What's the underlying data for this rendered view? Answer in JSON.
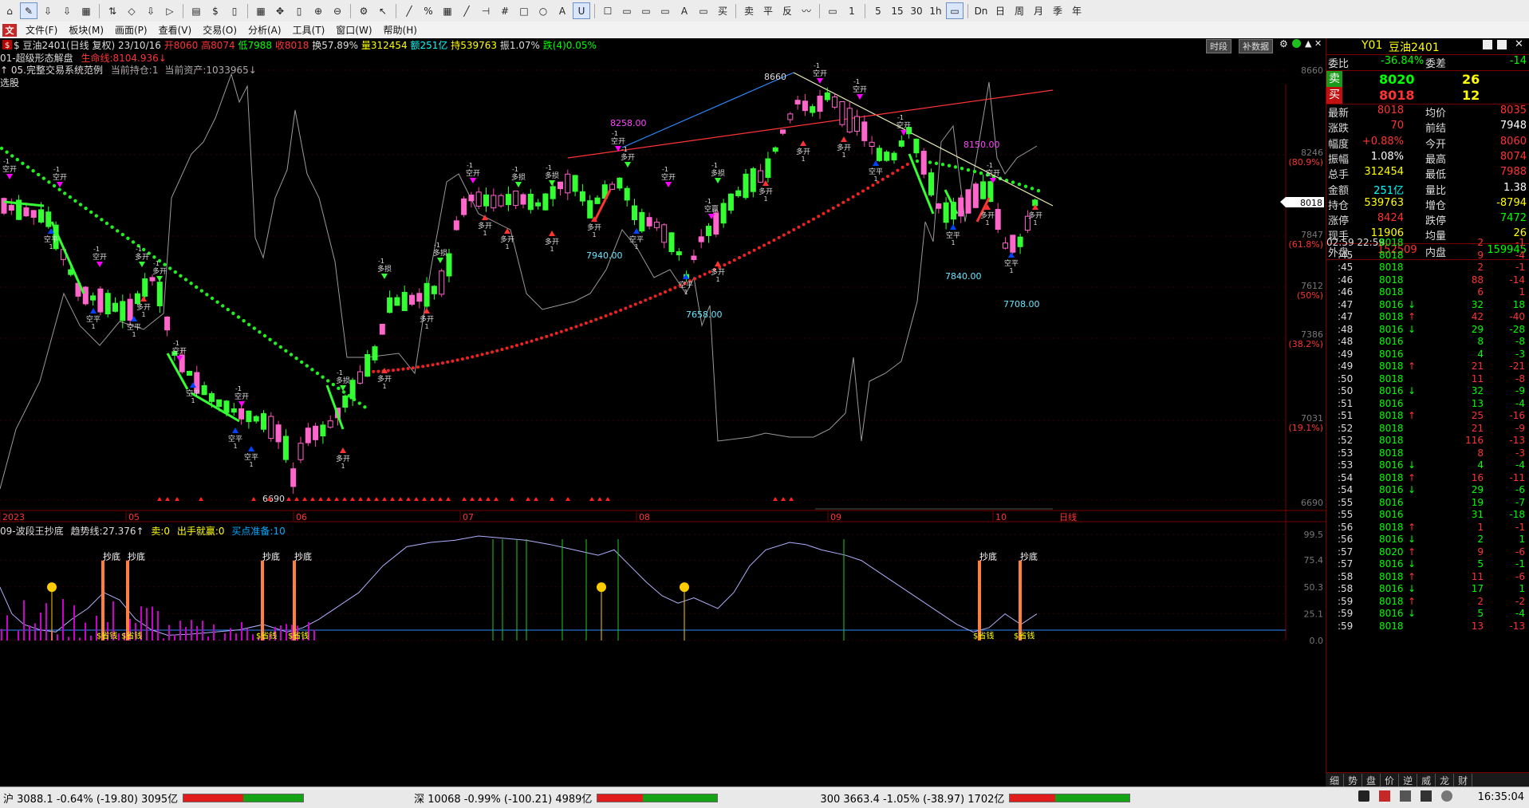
{
  "toolbar": {
    "items": [
      "⌂",
      "✎",
      "⇩",
      "⇩",
      "▦",
      "⇅",
      "◇",
      "⇩",
      "▷",
      "▤",
      "$",
      "▯",
      "▦",
      "✥",
      "▯",
      "⊕",
      "⊖",
      "⚙",
      "↖",
      "╱",
      "%",
      "▦",
      "╱",
      "⊣",
      "#",
      "□",
      "○",
      "A",
      "U",
      "☐",
      "▭",
      "▭",
      "▭",
      "A",
      "▭",
      "买",
      "卖",
      "平",
      "反",
      "〰",
      "▭",
      "1",
      "5",
      "15",
      "30",
      "1h",
      "▭",
      "Dn",
      "日",
      "周",
      "月",
      "季",
      "年"
    ],
    "selected": [
      1,
      28,
      46
    ]
  },
  "menu": {
    "items": [
      "文件(F)",
      "板块(M)",
      "画面(P)",
      "查看(V)",
      "交易(O)",
      "分析(A)",
      "工具(T)",
      "窗口(W)",
      "帮助(H)"
    ]
  },
  "chart": {
    "title_prefix": "$ 豆油2401(日线 复权) 23/10/16",
    "open_label": "开8060",
    "high_label": "高8074",
    "low_label": "低7988",
    "close_label": "收8018",
    "turnover_label": "换57.89%",
    "volume_label": "量312454",
    "amount_label": "额251亿",
    "position_label": "持539763",
    "amplitude_label": "振1.07%",
    "fall_label": "跌(4)0.05%",
    "line2_name": "01-超级形态解盘",
    "line2_value": "生命线:8104.936↓",
    "line3_name": "↑ 05.完整交易系统范例",
    "line3_hold": "当前持仓:1",
    "line3_assets": "当前资产:1033965↓",
    "line4": "选股",
    "btn_time": "时段",
    "btn_supp": "补数据",
    "right_axis": [
      "8660",
      "8246",
      "(80.9%)",
      "7847",
      "(61.8%)",
      "7612",
      "(50%)",
      "7386",
      "(38.2%)",
      "7031",
      "(19.1%)",
      "6690"
    ],
    "price_tag": "8018",
    "date_axis": [
      "2023",
      "05",
      "06",
      "07",
      "08",
      "09",
      "10",
      "日线"
    ],
    "annotations": [
      "8660",
      "8258.00",
      "8150.00",
      "7940.00",
      "7658.00",
      "7840.00",
      "7708.00",
      "6690"
    ],
    "signals": [
      "空开",
      "多开",
      "空平",
      "多平",
      "多损",
      "空赢",
      "多赢",
      "空损",
      "-1",
      "1"
    ]
  },
  "indicator": {
    "name": "09-波段王抄底",
    "trend_label": "趋势线:27.376↑",
    "sell_label": "卖:0",
    "hand_label": "出手就赢:0",
    "buy_label": "买点准备:10",
    "axis": [
      "99.5",
      "75.4",
      "50.3",
      "25.1",
      "0.0"
    ],
    "tag_bottom": "抄底",
    "tag_money": "$省钱"
  },
  "quote": {
    "code": "Y01",
    "name": "豆油2401",
    "webi_label": "委比",
    "webi": "-36.84%",
    "weicha_label": "委差",
    "weicha": "-14",
    "sell_label": "卖",
    "sell_price": "8020",
    "sell_vol": "26",
    "buy_label": "买",
    "buy_price": "8018",
    "buy_vol": "12",
    "rows": [
      {
        "l1": "最新",
        "v1": "8018",
        "c1": "#ff3333",
        "l2": "均价",
        "v2": "8035",
        "c2": "#ff3333"
      },
      {
        "l1": "涨跌",
        "v1": "70",
        "c1": "#ff3333",
        "l2": "前结",
        "v2": "7948",
        "c2": "#ffffff"
      },
      {
        "l1": "幅度",
        "v1": "+0.88%",
        "c1": "#ff3333",
        "l2": "今开",
        "v2": "8060",
        "c2": "#ff3333"
      },
      {
        "l1": "振幅",
        "v1": "1.08%",
        "c1": "#ffffff",
        "l2": "最高",
        "v2": "8074",
        "c2": "#ff3333"
      },
      {
        "l1": "总手",
        "v1": "312454",
        "c1": "#ffff00",
        "l2": "最低",
        "v2": "7988",
        "c2": "#ff3333"
      },
      {
        "l1": "金额",
        "v1": "251亿",
        "c1": "#00ffff",
        "l2": "量比",
        "v2": "1.38",
        "c2": "#ffffff"
      },
      {
        "l1": "持仓",
        "v1": "539763",
        "c1": "#ffff00",
        "l2": "增仓",
        "v2": "-8794",
        "c2": "#ffff00"
      },
      {
        "l1": "涨停",
        "v1": "8424",
        "c1": "#ff3333",
        "l2": "跌停",
        "v2": "7472",
        "c2": "#00ff00"
      },
      {
        "l1": "现手",
        "v1": "11906",
        "c1": "#ffff00",
        "l2": "均量",
        "v2": "26",
        "c2": "#ffff00"
      }
    ],
    "outer_label": "外盘",
    "outer": "152509",
    "inner_label": "内盘",
    "inner": "159945"
  },
  "ticks": [
    {
      "t": "02:59 22:59",
      "p": "8018",
      "a": "",
      "v": "2",
      "d": "-1",
      "pc": "#00ff00",
      "vc": "#ff3333"
    },
    {
      "t": ":45",
      "p": "8018",
      "a": "",
      "v": "9",
      "d": "-4",
      "pc": "#00ff00",
      "vc": "#ff3333"
    },
    {
      "t": ":45",
      "p": "8018",
      "a": "",
      "v": "2",
      "d": "-1",
      "pc": "#00ff00",
      "vc": "#ff3333"
    },
    {
      "t": ":46",
      "p": "8018",
      "a": "",
      "v": "88",
      "d": "-14",
      "pc": "#00ff00",
      "vc": "#ff3333"
    },
    {
      "t": ":46",
      "p": "8018",
      "a": "",
      "v": "6",
      "d": "1",
      "pc": "#00ff00",
      "vc": "#ff3333"
    },
    {
      "t": ":47",
      "p": "8016",
      "a": "↓",
      "v": "32",
      "d": "18",
      "pc": "#00ff00",
      "vc": "#00ff00"
    },
    {
      "t": ":47",
      "p": "8018",
      "a": "↑",
      "v": "42",
      "d": "-40",
      "pc": "#00ff00",
      "vc": "#ff3333"
    },
    {
      "t": ":48",
      "p": "8016",
      "a": "↓",
      "v": "29",
      "d": "-28",
      "pc": "#00ff00",
      "vc": "#00ff00"
    },
    {
      "t": ":48",
      "p": "8016",
      "a": "",
      "v": "8",
      "d": "-8",
      "pc": "#00ff00",
      "vc": "#00ff00"
    },
    {
      "t": ":49",
      "p": "8016",
      "a": "",
      "v": "4",
      "d": "-3",
      "pc": "#00ff00",
      "vc": "#00ff00"
    },
    {
      "t": ":49",
      "p": "8018",
      "a": "↑",
      "v": "21",
      "d": "-21",
      "pc": "#00ff00",
      "vc": "#ff3333"
    },
    {
      "t": ":50",
      "p": "8018",
      "a": "",
      "v": "11",
      "d": "-8",
      "pc": "#00ff00",
      "vc": "#ff3333"
    },
    {
      "t": ":50",
      "p": "8016",
      "a": "↓",
      "v": "32",
      "d": "-9",
      "pc": "#00ff00",
      "vc": "#00ff00"
    },
    {
      "t": ":51",
      "p": "8016",
      "a": "",
      "v": "13",
      "d": "-4",
      "pc": "#00ff00",
      "vc": "#00ff00"
    },
    {
      "t": ":51",
      "p": "8018",
      "a": "↑",
      "v": "25",
      "d": "-16",
      "pc": "#00ff00",
      "vc": "#ff3333"
    },
    {
      "t": ":52",
      "p": "8018",
      "a": "",
      "v": "21",
      "d": "-9",
      "pc": "#00ff00",
      "vc": "#ff3333"
    },
    {
      "t": ":52",
      "p": "8018",
      "a": "",
      "v": "116",
      "d": "-13",
      "pc": "#00ff00",
      "vc": "#ff3333"
    },
    {
      "t": ":53",
      "p": "8018",
      "a": "",
      "v": "8",
      "d": "-3",
      "pc": "#00ff00",
      "vc": "#ff3333"
    },
    {
      "t": ":53",
      "p": "8016",
      "a": "↓",
      "v": "4",
      "d": "-4",
      "pc": "#00ff00",
      "vc": "#00ff00"
    },
    {
      "t": ":54",
      "p": "8018",
      "a": "↑",
      "v": "16",
      "d": "-11",
      "pc": "#00ff00",
      "vc": "#ff3333"
    },
    {
      "t": ":54",
      "p": "8016",
      "a": "↓",
      "v": "29",
      "d": "-6",
      "pc": "#00ff00",
      "vc": "#00ff00"
    },
    {
      "t": ":55",
      "p": "8016",
      "a": "",
      "v": "19",
      "d": "-7",
      "pc": "#00ff00",
      "vc": "#00ff00"
    },
    {
      "t": ":55",
      "p": "8016",
      "a": "",
      "v": "31",
      "d": "-18",
      "pc": "#00ff00",
      "vc": "#00ff00"
    },
    {
      "t": ":56",
      "p": "8018",
      "a": "↑",
      "v": "1",
      "d": "-1",
      "pc": "#00ff00",
      "vc": "#ff3333"
    },
    {
      "t": ":56",
      "p": "8016",
      "a": "↓",
      "v": "2",
      "d": "1",
      "pc": "#00ff00",
      "vc": "#00ff00"
    },
    {
      "t": ":57",
      "p": "8020",
      "a": "↑",
      "v": "9",
      "d": "-6",
      "pc": "#00ff00",
      "vc": "#ff3333"
    },
    {
      "t": ":57",
      "p": "8016",
      "a": "↓",
      "v": "5",
      "d": "-1",
      "pc": "#00ff00",
      "vc": "#00ff00"
    },
    {
      "t": ":58",
      "p": "8018",
      "a": "↑",
      "v": "11",
      "d": "-6",
      "pc": "#00ff00",
      "vc": "#ff3333"
    },
    {
      "t": ":58",
      "p": "8016",
      "a": "↓",
      "v": "17",
      "d": "1",
      "pc": "#00ff00",
      "vc": "#00ff00"
    },
    {
      "t": ":59",
      "p": "8018",
      "a": "↑",
      "v": "2",
      "d": "-2",
      "pc": "#00ff00",
      "vc": "#ff3333"
    },
    {
      "t": ":59",
      "p": "8016",
      "a": "↓",
      "v": "5",
      "d": "-4",
      "pc": "#00ff00",
      "vc": "#00ff00"
    },
    {
      "t": ":59",
      "p": "8018",
      "a": "",
      "v": "13",
      "d": "-13",
      "pc": "#00ff00",
      "vc": "#ff3333"
    }
  ],
  "tabs": [
    "细",
    "势",
    "盘",
    "价",
    "逆",
    "威",
    "龙",
    "财"
  ],
  "status": {
    "sh": "沪 3088.1 -0.64% (-19.80) 3095亿",
    "sz": "深 10068 -0.99% (-100.21) 4989亿",
    "hs300": "300 3663.4 -1.05% (-38.97) 1702亿",
    "time": "16:35:04"
  },
  "colors": {
    "up": "#ff3333",
    "down": "#00ff00",
    "pink": "#ff66cc",
    "cyan": "#00ffff",
    "yellow": "#ffff00",
    "orange": "#ff7f3f",
    "magenta": "#ff00ff"
  }
}
